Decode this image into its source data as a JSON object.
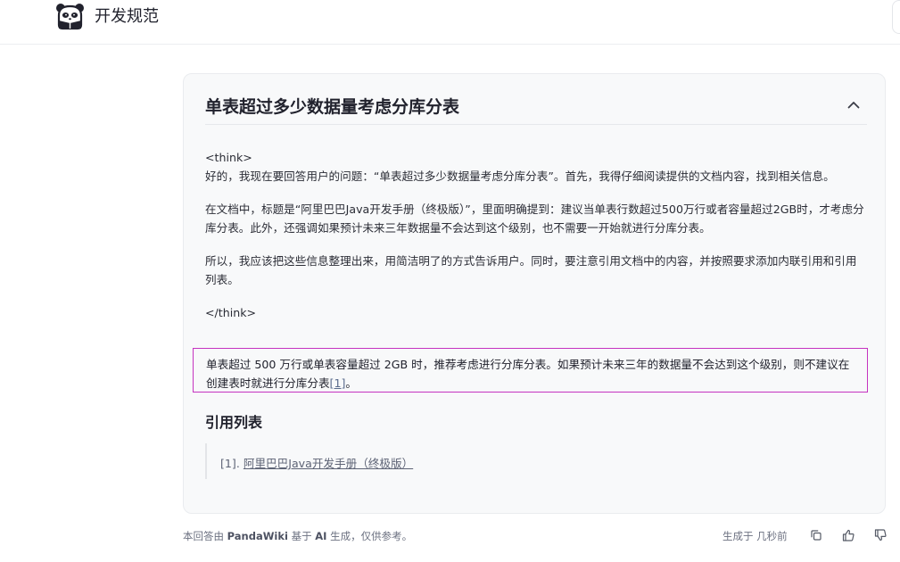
{
  "header": {
    "brand": "开发规范",
    "logo_icon": "panda-logo-icon"
  },
  "card": {
    "title": "单表超过多少数据量考虑分库分表",
    "collapse_icon": "chevron-up-icon",
    "think_open": "<think>",
    "think_paragraphs": [
      "好的，我现在要回答用户的问题：“单表超过多少数据量考虑分库分表”。首先，我得仔细阅读提供的文档内容，找到相关信息。",
      "在文档中，标题是“阿里巴巴Java开发手册（终极版）”，里面明确提到：建议当单表行数超过500万行或者容量超过2GB时，才考虑分库分表。此外，还强调如果预计未来三年数据量不会达到这个级别，也不需要一开始就进行分库分表。",
      "所以，我应该把这些信息整理出来，用简洁明了的方式告诉用户。同时，要注意引用文档中的内容，并按照要求添加内联引用和引用列表。"
    ],
    "think_close": "</think>",
    "answer_text": "单表超过 500 万行或单表容量超过 2GB 时，推荐考虑进行分库分表。如果预计未来三年的数据量不会达到这个级别，则不建议在创建表时就进行分库分表",
    "answer_cite": "[1]",
    "answer_end": "。",
    "references_heading": "引用列表",
    "references": [
      {
        "index": "[1].",
        "title": "阿里巴巴Java开发手册（终极版）"
      }
    ]
  },
  "footer": {
    "disclaimer_prefix": "本回答由 ",
    "disclaimer_brand": "PandaWiki",
    "disclaimer_mid": " 基于 ",
    "disclaimer_ai": "AI",
    "disclaimer_suffix": " 生成，仅供参考。",
    "generated_time": "生成于 几秒前",
    "icons": [
      "copy-icon",
      "thumbs-up-icon",
      "thumbs-down-icon"
    ]
  },
  "colors": {
    "accent_border": "#c533c0",
    "card_bg": "#f8f9fa",
    "link": "#5a6b8c"
  }
}
